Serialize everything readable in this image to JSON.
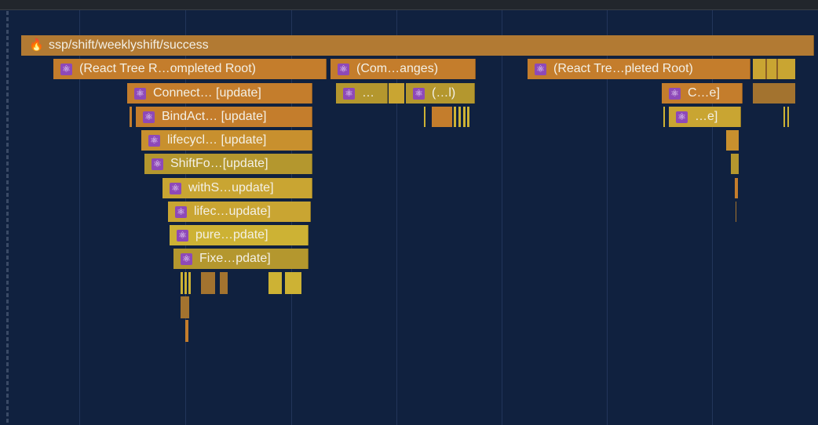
{
  "flamegraph": {
    "root": {
      "label": "ssp/shift/weeklyshift/success",
      "icon": "flame-icon"
    },
    "level1": [
      {
        "label": "(React Tree R…ompleted Root)",
        "icon": "react-icon"
      },
      {
        "label": "(Com…anges)",
        "icon": "react-icon"
      },
      {
        "label": "(React Tre…pleted Root)",
        "icon": "react-icon"
      }
    ],
    "level2": [
      {
        "label": "Connect… [update]",
        "icon": "react-icon"
      },
      {
        "label": "…",
        "icon": "react-icon"
      },
      {
        "label": "(…l)",
        "icon": "react-icon"
      },
      {
        "label": "C…e]",
        "icon": "react-icon"
      }
    ],
    "level3": [
      {
        "label": "BindAct… [update]",
        "icon": "react-icon"
      },
      {
        "label": "…e]",
        "icon": "react-icon"
      }
    ],
    "stack": [
      {
        "label": "lifecycl… [update]",
        "icon": "react-icon"
      },
      {
        "label": "ShiftFo…[update]",
        "icon": "react-icon"
      },
      {
        "label": "withS…update]",
        "icon": "react-icon"
      },
      {
        "label": "lifec…update]",
        "icon": "react-icon"
      },
      {
        "label": "pure…pdate]",
        "icon": "react-icon"
      },
      {
        "label": "Fixe…pdate]",
        "icon": "react-icon"
      }
    ]
  },
  "icons": {
    "react": "⚛",
    "flame": "🔥"
  }
}
